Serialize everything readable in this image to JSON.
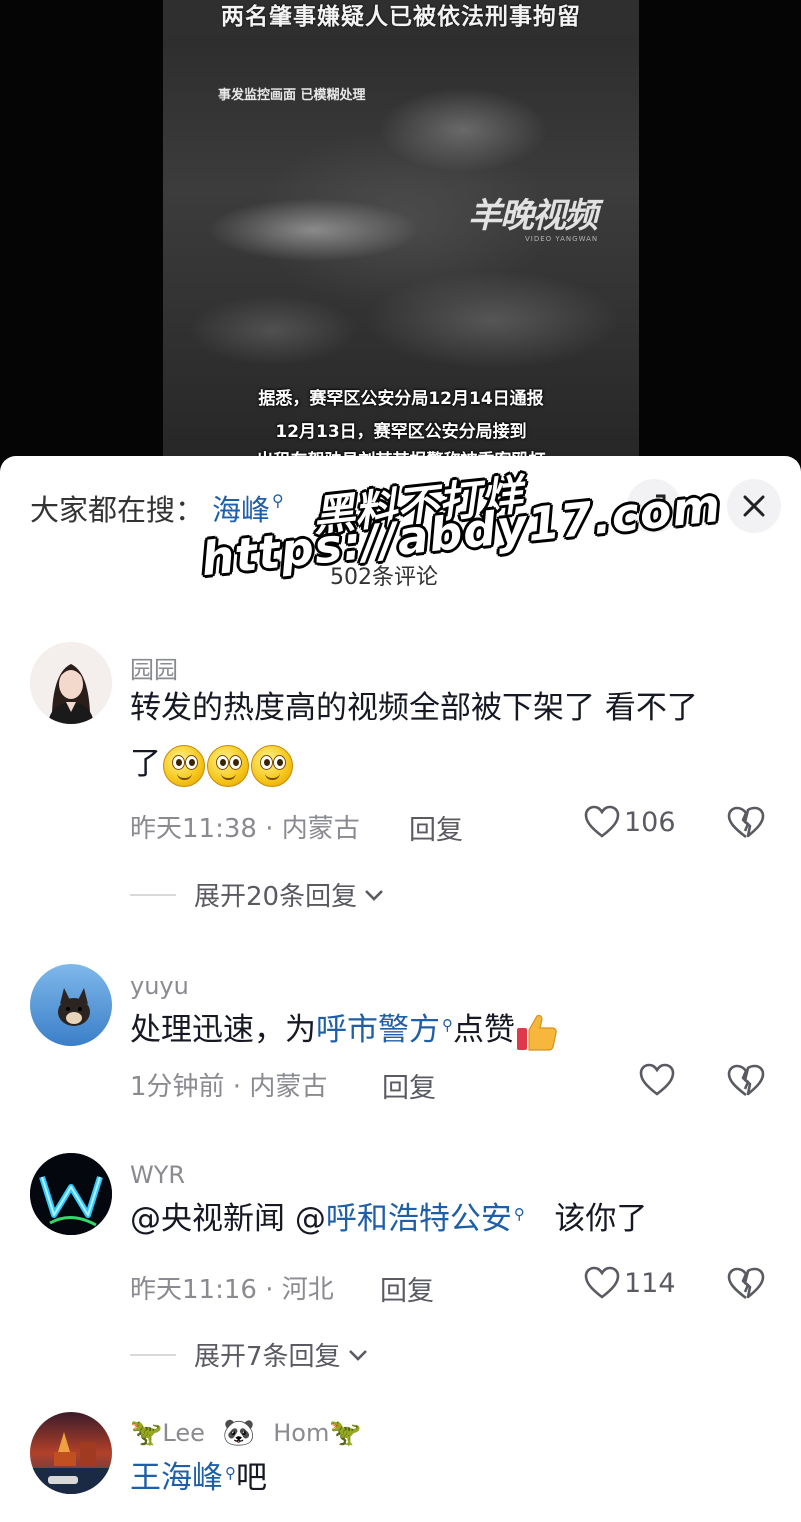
{
  "video": {
    "headline": "两名肇事嫌疑人已被依法刑事拘留",
    "caption_small": "事发监控画面 已模糊处理",
    "logo": "羊晚视频",
    "logo_sub": "VIDEO YANGWAN",
    "subtitle_1": "据悉，赛罕区公安分局12月14日通报",
    "subtitle_2": "12月13日，赛罕区公安分局接到",
    "subtitle_3": "出租车驾驶员刘某某报警称被乘客殴打"
  },
  "search": {
    "label": "大家都在搜：",
    "term": "海峰"
  },
  "watermark": {
    "line1": "黑料不打烊",
    "line2": "https://abdy17.com"
  },
  "comment_count": "502条评论",
  "comments": [
    {
      "username": "园园",
      "text_1": "转发的热度高的视频全部被下架了  看不了",
      "text_2": "了",
      "time": "昨天11:38 · 内蒙古",
      "reply": "回复",
      "likes": "106",
      "expand": "展开20条回复"
    },
    {
      "username": "yuyu",
      "text_pre": "处理迅速，为",
      "link": "呼市警方",
      "text_post": "点赞",
      "time": "1分钟前 · 内蒙古",
      "reply": "回复"
    },
    {
      "username": "WYR",
      "text_pre": "@央视新闻 @",
      "link": "呼和浩特公安",
      "text_post": "   该你了",
      "time": "昨天11:16 · 河北",
      "reply": "回复",
      "likes": "114",
      "expand": "展开7条回复"
    },
    {
      "username_1": "Lee",
      "username_2": "Hom",
      "link": "王海峰",
      "text_post": "吧"
    }
  ],
  "colors": {
    "link": "#1f5fa8",
    "muted": "#8a8b91",
    "text": "#161823"
  }
}
